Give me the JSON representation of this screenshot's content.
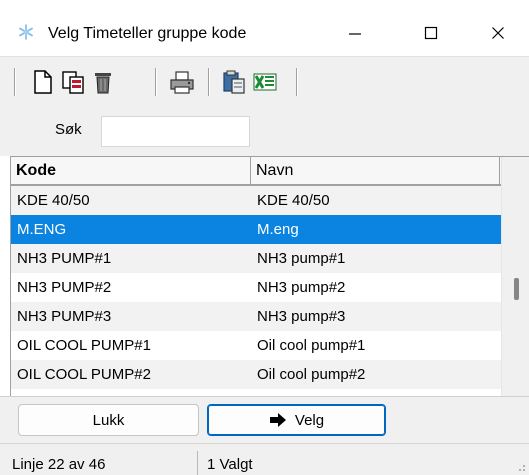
{
  "window": {
    "title": "Velg Timeteller gruppe kode",
    "app_icon": "snowflake-icon",
    "controls": [
      "minimize-icon",
      "maximize-icon",
      "close-icon"
    ]
  },
  "toolbar": {
    "buttons": [
      "new-document-icon",
      "copy-record-icon",
      "delete-trash-icon",
      "print-icon",
      "paste-clipboard-icon",
      "excel-export-icon"
    ]
  },
  "search": {
    "label": "Søk",
    "value": ""
  },
  "grid": {
    "columns": [
      "Kode",
      "Navn"
    ],
    "rows": [
      {
        "kode": "KDE 40/50",
        "navn": "KDE 40/50"
      },
      {
        "kode": "M.ENG",
        "navn": "M.eng",
        "selected": true
      },
      {
        "kode": "NH3 PUMP#1",
        "navn": "NH3 pump#1"
      },
      {
        "kode": "NH3 PUMP#2",
        "navn": "NH3 pump#2"
      },
      {
        "kode": "NH3 PUMP#3",
        "navn": "NH3 pump#3"
      },
      {
        "kode": "OIL COOL PUMP#1",
        "navn": "Oil cool pump#1"
      },
      {
        "kode": "OIL COOL PUMP#2",
        "navn": "Oil cool pump#2"
      }
    ],
    "selected_row_color": "#0a84e0"
  },
  "buttons": {
    "lukk": "Lukk",
    "velg": "Velg",
    "velg_icon": "arrow-right-icon"
  },
  "status": {
    "position": "Linje 22 av 46",
    "selection": "1 Valgt"
  }
}
